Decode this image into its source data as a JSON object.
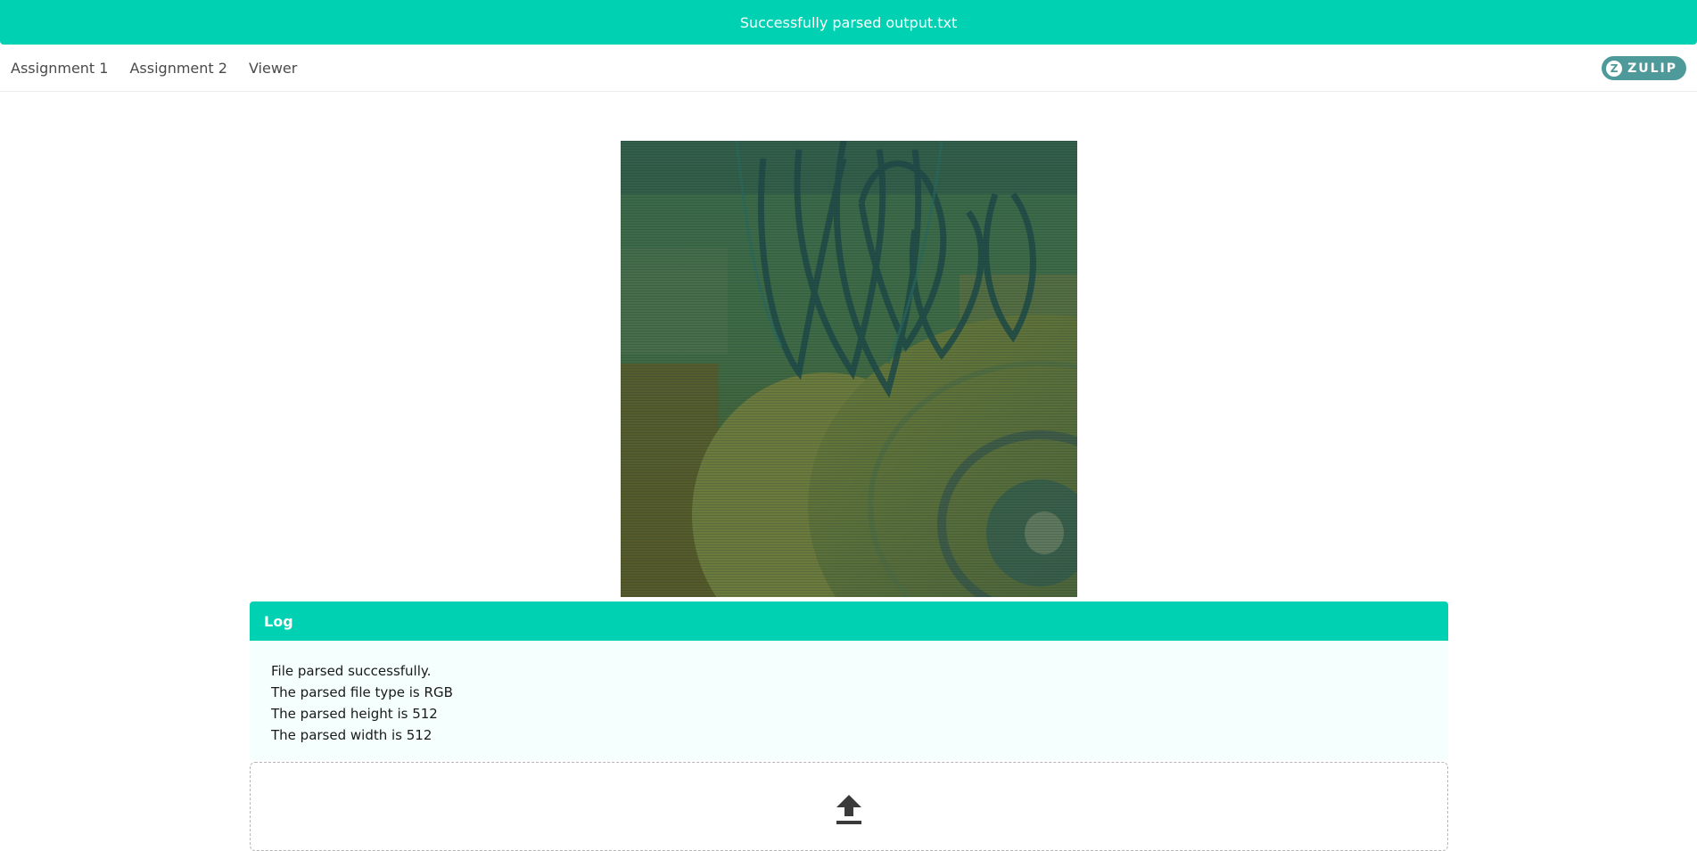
{
  "notification": {
    "message": "Successfully parsed output.txt"
  },
  "navbar": {
    "items": [
      {
        "label": "Assignment 1"
      },
      {
        "label": "Assignment 2"
      },
      {
        "label": "Viewer"
      }
    ],
    "zulip": {
      "icon_letter": "Z",
      "label": "ZULIP"
    }
  },
  "viewer": {
    "image_description_icon": "rendered-rgb-image"
  },
  "log": {
    "title": "Log",
    "lines": [
      "File parsed successfully.",
      "The parsed file type is RGB",
      "The parsed height is 512",
      "The parsed width is 512"
    ]
  },
  "upload": {
    "icon": "upload-icon"
  },
  "colors": {
    "accent": "#00d1b2",
    "zulip": "#4e9a9b",
    "log_bg": "#f5fffd"
  }
}
